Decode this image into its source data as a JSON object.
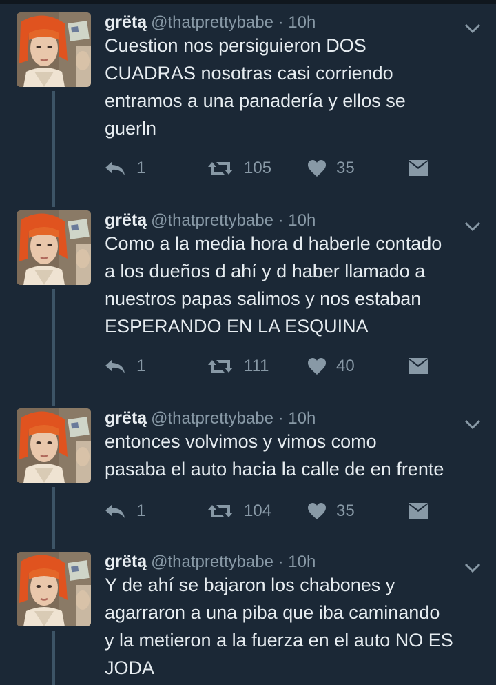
{
  "colors": {
    "background": "#1b2836",
    "name": "#e8edf1",
    "secondary": "#8899a6",
    "thread_line": "#3d5466"
  },
  "icons": {
    "reply": "reply-icon",
    "retweet": "retweet-icon",
    "like": "heart-icon",
    "dm": "envelope-icon",
    "menu": "chevron-down-icon"
  },
  "tweets": [
    {
      "name": "grëtą",
      "handle": "@thatprettybabe · 10h",
      "lines": [
        "Cuestion nos persiguieron DOS",
        "CUADRAS nosotras casi corriendo",
        "entramos a una panadería y ellos se",
        "guerln"
      ],
      "replies": "1",
      "retweets": "105",
      "likes": "35"
    },
    {
      "name": "grëtą",
      "handle": "@thatprettybabe · 10h",
      "lines": [
        "Como a la media hora d haberle contado",
        "a los dueños d ahí y d haber llamado a",
        "nuestros papas salimos y nos estaban",
        "ESPERANDO EN LA ESQUINA"
      ],
      "replies": "1",
      "retweets": "111",
      "likes": "40"
    },
    {
      "name": "grëtą",
      "handle": "@thatprettybabe · 10h",
      "lines": [
        "entonces volvimos y vimos como",
        "pasaba el auto hacia la calle de en frente"
      ],
      "replies": "1",
      "retweets": "104",
      "likes": "35"
    },
    {
      "name": "grëtą",
      "handle": "@thatprettybabe · 10h",
      "lines": [
        "Y de ahí se bajaron los chabones y",
        "agarraron a una piba que iba caminando",
        "y la metieron a la fuerza en el auto NO ES",
        "JODA"
      ]
    }
  ]
}
